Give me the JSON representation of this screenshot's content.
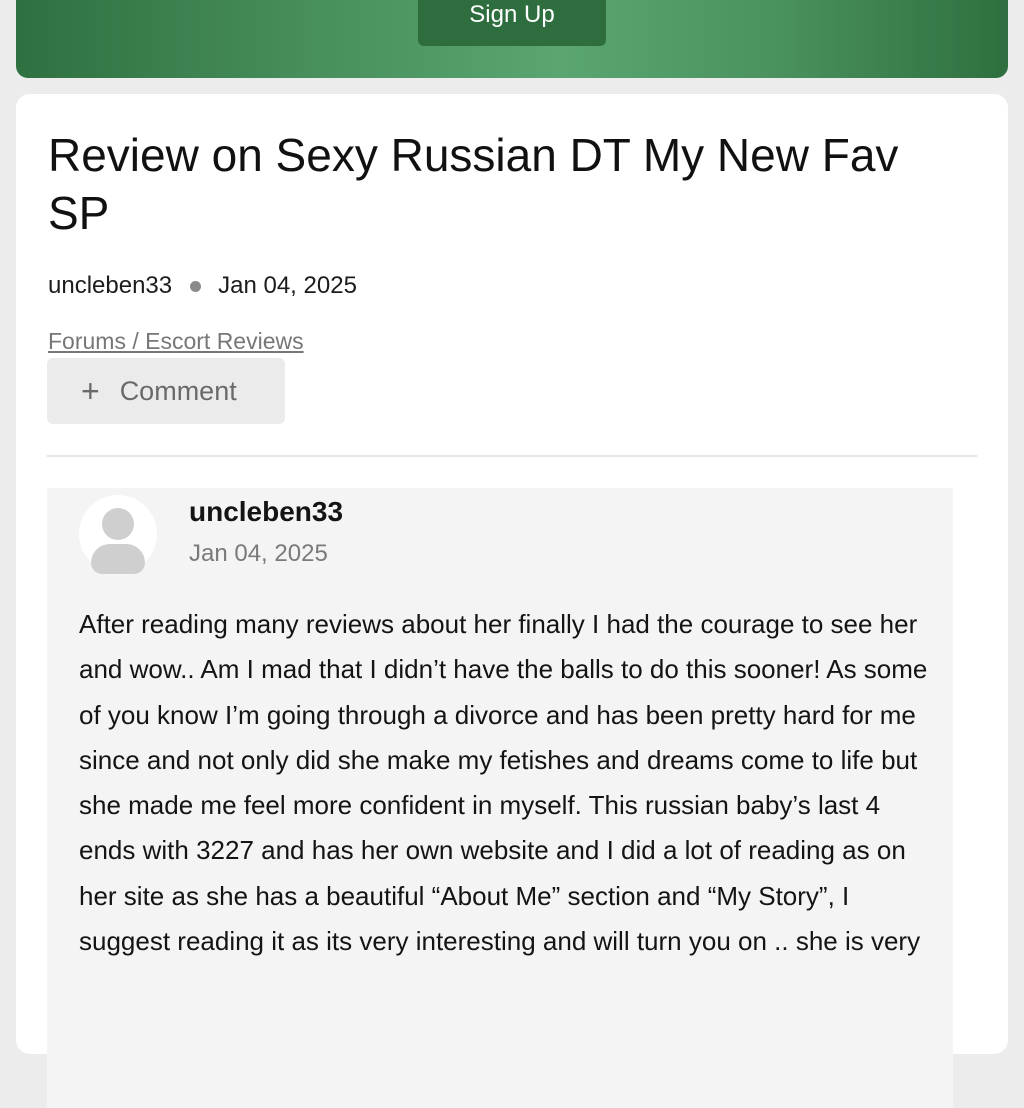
{
  "header": {
    "signup_label": "Sign Up"
  },
  "topic": {
    "title": "Review on Sexy Russian DT My New Fav SP",
    "author": "uncleben33",
    "date": "Jan 04, 2025",
    "breadcrumb": "Forums / Escort Reviews",
    "comment_label": "Comment"
  },
  "post": {
    "author": "uncleben33",
    "date": "Jan 04, 2025",
    "body": "After reading many reviews about her finally I had the courage to see her and wow.. Am I mad that I didn’t have the balls to do this sooner! As some of you know I’m going through a divorce and has been pretty hard for me since and not only did she make my fetishes and dreams come to life but she made me feel more confident in myself. This russian baby’s last 4 ends with 3227 and has her own website and I did a lot of reading as on her site as she has a beautiful “About Me” section and “My Story”, I suggest reading it as its very interesting and will turn you on .. she is very"
  },
  "icons": {
    "plus": "plus-icon",
    "avatar": "user-avatar-icon",
    "separator": "dot-separator"
  },
  "colors": {
    "banner_green": "#4b9460",
    "button_green": "#2e6e3e"
  }
}
